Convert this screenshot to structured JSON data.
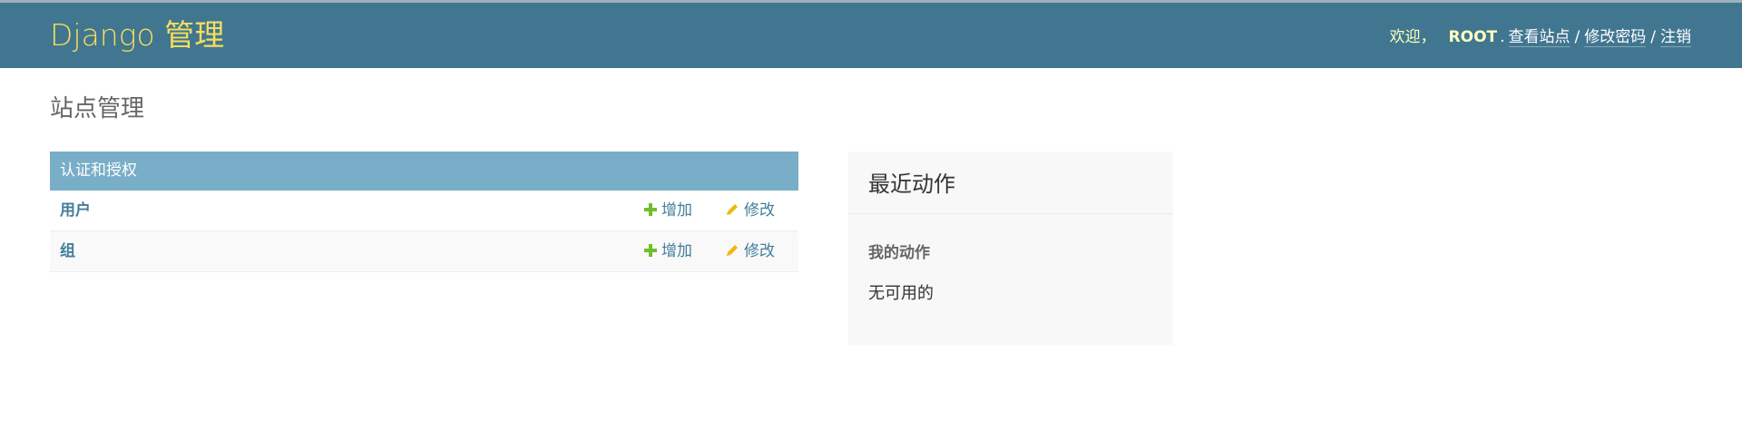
{
  "header": {
    "branding": "Django 管理",
    "welcome": "欢迎，",
    "username": "ROOT",
    "links": {
      "view_site": "查看站点",
      "change_password": "修改密码",
      "logout": "注销"
    },
    "separator": "/"
  },
  "main": {
    "title": "站点管理",
    "apps": [
      {
        "caption": "认证和授权",
        "models": [
          {
            "name": "用户",
            "add_label": "增加",
            "change_label": "修改"
          },
          {
            "name": "组",
            "add_label": "增加",
            "change_label": "修改"
          }
        ]
      }
    ]
  },
  "sidebar": {
    "recent_actions_title": "最近动作",
    "my_actions_title": "我的动作",
    "empty_message": "无可用的"
  },
  "colors": {
    "header_bg": "#417690",
    "branding": "#f5dd5d",
    "module_caption_bg": "#79aec8",
    "link": "#447e9b",
    "add_icon": "#70bf2b",
    "change_icon": "#efb80b",
    "sidebar_bg": "#f8f8f8"
  },
  "icons": {
    "add": "plus-icon",
    "change": "pencil-icon"
  }
}
